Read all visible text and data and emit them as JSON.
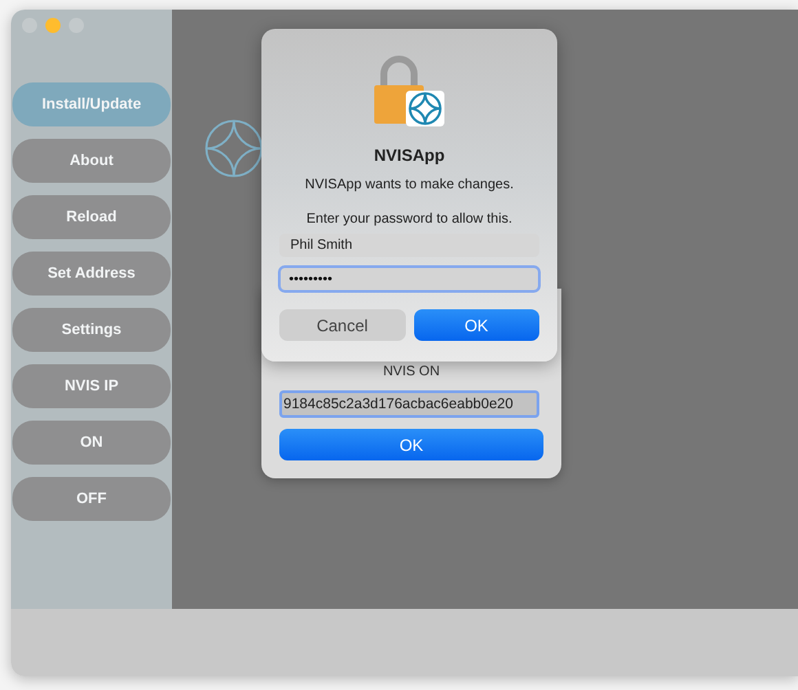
{
  "window": {
    "controls": [
      {
        "color": "#c3c9cb"
      },
      {
        "color": "#febc2e"
      },
      {
        "color": "#c3c9cb"
      }
    ]
  },
  "sidebar": {
    "items": [
      {
        "label": "Install/Update",
        "selected": true
      },
      {
        "label": "About",
        "selected": false
      },
      {
        "label": "Reload",
        "selected": false
      },
      {
        "label": "Set Address",
        "selected": false
      },
      {
        "label": "Settings",
        "selected": false
      },
      {
        "label": "NVIS IP",
        "selected": false
      },
      {
        "label": "ON",
        "selected": false
      },
      {
        "label": "OFF",
        "selected": false
      }
    ]
  },
  "sheet": {
    "label": "NVIS ON",
    "field_value": "9184c85c2a3d176acbac6eabb0e20",
    "button": "OK"
  },
  "auth_dialog": {
    "title": "NVISApp",
    "message": "NVISApp wants to make changes.",
    "prompt": "Enter your password to allow this.",
    "username": "Phil Smith",
    "password": "•••••••••",
    "buttons": [
      {
        "label": "Cancel",
        "kind": "secondary"
      },
      {
        "label": "OK",
        "kind": "primary"
      }
    ]
  }
}
